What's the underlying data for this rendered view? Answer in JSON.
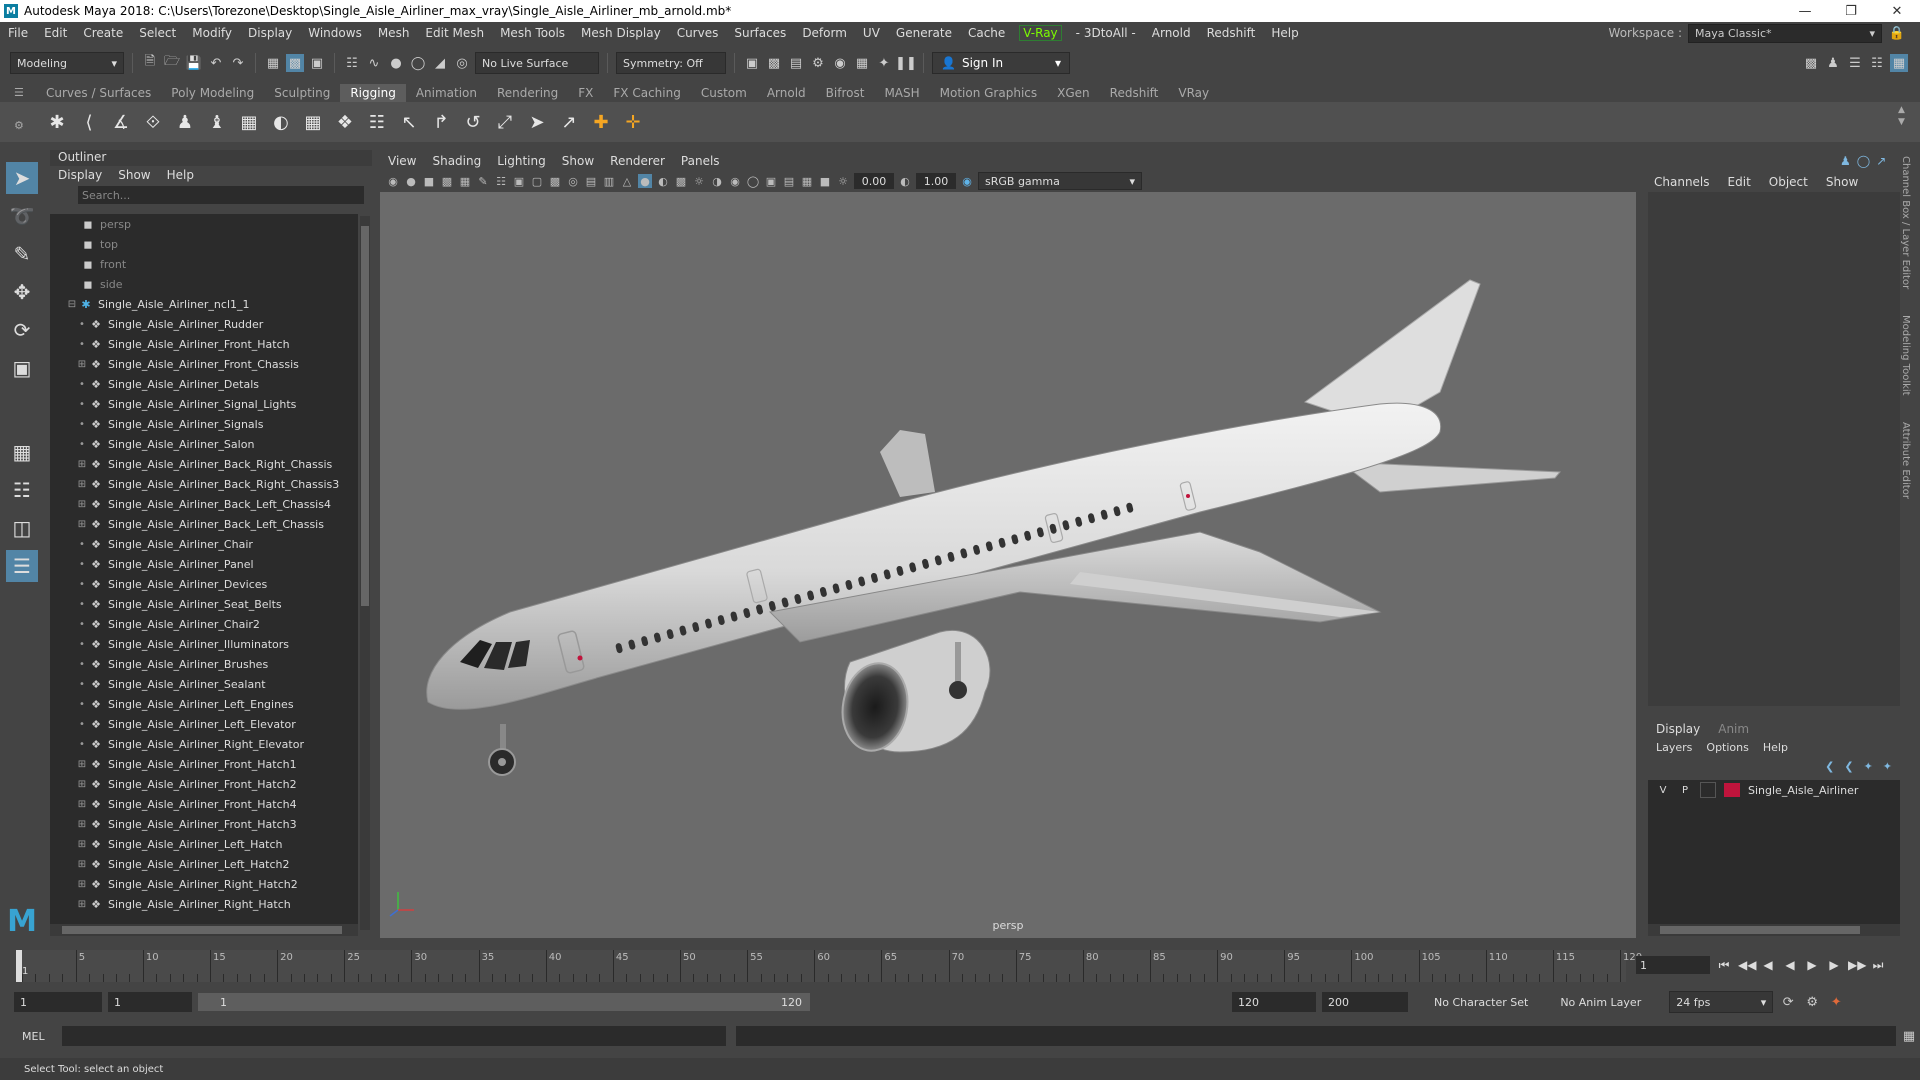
{
  "window": {
    "title": "Autodesk Maya 2018: C:\\Users\\Torezone\\Desktop\\Single_Aisle_Airliner_max_vray\\Single_Aisle_Airliner_mb_arnold.mb*",
    "logo": "M"
  },
  "menubar": {
    "items": [
      "File",
      "Edit",
      "Create",
      "Select",
      "Modify",
      "Display",
      "Windows",
      "Mesh",
      "Edit Mesh",
      "Mesh Tools",
      "Mesh Display",
      "Curves",
      "Surfaces",
      "Deform",
      "UV",
      "Generate",
      "Cache"
    ],
    "vray": "V-Ray",
    "items2": [
      "- 3DtoAll -",
      "Arnold",
      "Redshift",
      "Help"
    ],
    "workspace_label": "Workspace :",
    "workspace_value": "Maya Classic*"
  },
  "statusline": {
    "mode": "Modeling",
    "live_surface": "No Live Surface",
    "symmetry": "Symmetry: Off",
    "sign_in": "Sign In"
  },
  "shelf": {
    "tabs": [
      "Curves / Surfaces",
      "Poly Modeling",
      "Sculpting",
      "Rigging",
      "Animation",
      "Rendering",
      "FX",
      "FX Caching",
      "Custom",
      "Arnold",
      "Bifrost",
      "MASH",
      "Motion Graphics",
      "XGen",
      "Redshift",
      "VRay"
    ],
    "active_tab": "Rigging"
  },
  "outliner": {
    "title": "Outliner",
    "menu": [
      "Display",
      "Show",
      "Help"
    ],
    "search_placeholder": "Search...",
    "cameras": [
      "persp",
      "top",
      "front",
      "side"
    ],
    "group": "Single_Aisle_Airliner_ncl1_1",
    "items": [
      {
        "name": "Single_Aisle_Airliner_Rudder",
        "expandable": false
      },
      {
        "name": "Single_Aisle_Airliner_Front_Hatch",
        "expandable": false
      },
      {
        "name": "Single_Aisle_Airliner_Front_Chassis",
        "expandable": true
      },
      {
        "name": "Single_Aisle_Airliner_Detals",
        "expandable": false
      },
      {
        "name": "Single_Aisle_Airliner_Signal_Lights",
        "expandable": false
      },
      {
        "name": "Single_Aisle_Airliner_Signals",
        "expandable": false
      },
      {
        "name": "Single_Aisle_Airliner_Salon",
        "expandable": false
      },
      {
        "name": "Single_Aisle_Airliner_Back_Right_Chassis",
        "expandable": true
      },
      {
        "name": "Single_Aisle_Airliner_Back_Right_Chassis3",
        "expandable": true
      },
      {
        "name": "Single_Aisle_Airliner_Back_Left_Chassis4",
        "expandable": true
      },
      {
        "name": "Single_Aisle_Airliner_Back_Left_Chassis",
        "expandable": true
      },
      {
        "name": "Single_Aisle_Airliner_Chair",
        "expandable": false
      },
      {
        "name": "Single_Aisle_Airliner_Panel",
        "expandable": false
      },
      {
        "name": "Single_Aisle_Airliner_Devices",
        "expandable": false
      },
      {
        "name": "Single_Aisle_Airliner_Seat_Belts",
        "expandable": false
      },
      {
        "name": "Single_Aisle_Airliner_Chair2",
        "expandable": false
      },
      {
        "name": "Single_Aisle_Airliner_Illuminators",
        "expandable": false
      },
      {
        "name": "Single_Aisle_Airliner_Brushes",
        "expandable": false
      },
      {
        "name": "Single_Aisle_Airliner_Sealant",
        "expandable": false
      },
      {
        "name": "Single_Aisle_Airliner_Left_Engines",
        "expandable": false
      },
      {
        "name": "Single_Aisle_Airliner_Left_Elevator",
        "expandable": false
      },
      {
        "name": "Single_Aisle_Airliner_Right_Elevator",
        "expandable": false
      },
      {
        "name": "Single_Aisle_Airliner_Front_Hatch1",
        "expandable": true
      },
      {
        "name": "Single_Aisle_Airliner_Front_Hatch2",
        "expandable": true
      },
      {
        "name": "Single_Aisle_Airliner_Front_Hatch4",
        "expandable": true
      },
      {
        "name": "Single_Aisle_Airliner_Front_Hatch3",
        "expandable": true
      },
      {
        "name": "Single_Aisle_Airliner_Left_Hatch",
        "expandable": true
      },
      {
        "name": "Single_Aisle_Airliner_Left_Hatch2",
        "expandable": true
      },
      {
        "name": "Single_Aisle_Airliner_Right_Hatch2",
        "expandable": true
      },
      {
        "name": "Single_Aisle_Airliner_Right_Hatch",
        "expandable": true
      }
    ]
  },
  "viewport": {
    "menu": [
      "View",
      "Shading",
      "Lighting",
      "Show",
      "Renderer",
      "Panels"
    ],
    "exposure": "0.00",
    "gamma": "1.00",
    "color_space": "sRGB gamma",
    "camera_label": "persp",
    "background_color": "#6b6b6b"
  },
  "channelbox": {
    "menu": [
      "Channels",
      "Edit",
      "Object",
      "Show"
    ],
    "side_tabs": [
      "Channel Box / Layer Editor",
      "Modeling Toolkit",
      "Attribute Editor"
    ]
  },
  "layers": {
    "tabs": [
      "Display",
      "Anim"
    ],
    "menu": [
      "Layers",
      "Options",
      "Help"
    ],
    "rows": [
      {
        "v": "V",
        "p": "P",
        "name": "Single_Aisle_Airliner",
        "color": "#c0143c"
      }
    ]
  },
  "timeline": {
    "ticks": [
      5,
      10,
      15,
      20,
      25,
      30,
      35,
      40,
      45,
      50,
      55,
      60,
      65,
      70,
      75,
      80,
      85,
      90,
      95,
      100,
      105,
      110,
      115,
      120
    ],
    "start_label": "1",
    "current_frame": "1"
  },
  "range": {
    "start": "1",
    "anim_start": "1",
    "range_start": "1",
    "range_end": "120",
    "anim_end": "120",
    "end": "200",
    "character_set": "No Character Set",
    "anim_layer": "No Anim Layer",
    "fps": "24 fps"
  },
  "command": {
    "label": "MEL",
    "help": "Select Tool: select an object"
  }
}
